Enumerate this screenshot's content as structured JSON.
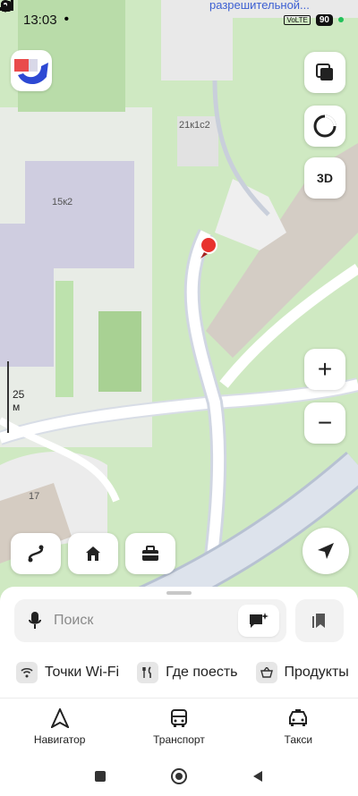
{
  "status_bar": {
    "time": "13:03",
    "network": "VoLTE",
    "battery": "90"
  },
  "map": {
    "top_label": "разрешительной...",
    "building_labels": [
      "21к1с2",
      "15к2",
      "17"
    ],
    "scale_text": "25 м",
    "buttons": {
      "layers": "layers-icon",
      "compass": "compass-icon",
      "three_d": "3D",
      "zoom_in": "+",
      "zoom_out": "−",
      "locate": "navigation-arrow-icon"
    },
    "shortcuts": [
      "route-icon",
      "home-icon",
      "work-icon"
    ]
  },
  "sheet": {
    "search_placeholder": "Поиск",
    "chips": [
      {
        "icon": "wifi-icon",
        "label": "Точки Wi-Fi"
      },
      {
        "icon": "fork-knife-icon",
        "label": "Где поесть"
      },
      {
        "icon": "basket-icon",
        "label": "Продукты"
      }
    ],
    "nav": [
      {
        "icon": "navigator-icon",
        "label": "Навигатор"
      },
      {
        "icon": "bus-icon",
        "label": "Транспорт"
      },
      {
        "icon": "taxi-icon",
        "label": "Такси"
      }
    ]
  },
  "colors": {
    "park": "#cfe9c2",
    "building": "#e9e9e9",
    "road": "#ffffff",
    "pin": "#e8322e",
    "accent": "#3c5fd2"
  }
}
